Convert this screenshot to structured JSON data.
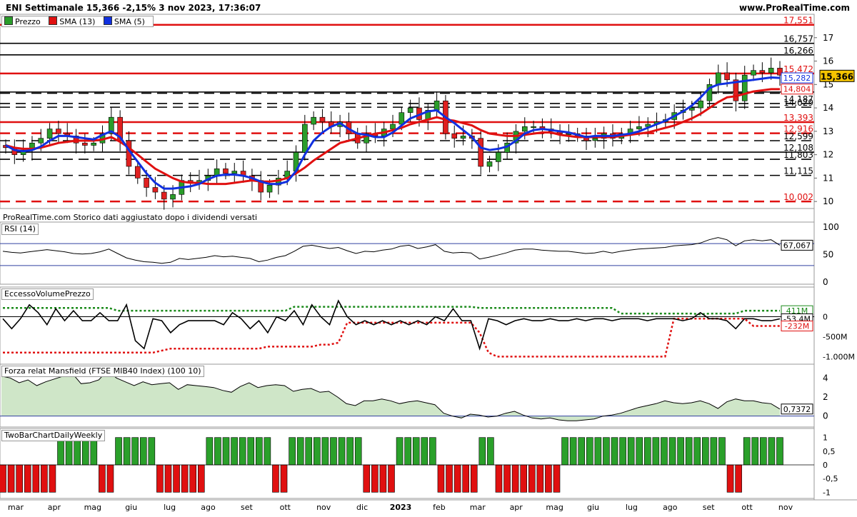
{
  "header": {
    "title": "ENI Settimanale 15,366 -2,15% 3 nov 2023, 17:36:07",
    "site": "www.ProRealTime.com"
  },
  "legend": {
    "price": "Prezzo",
    "sma13": "SMA (13)",
    "sma5": "SMA (5)"
  },
  "footer_note": "ProRealTime.com  Storico dati aggiustato dopo i dividendi versati",
  "colors": {
    "bull": "#2a9d2a",
    "bear": "#e02020",
    "sma13": "#e01010",
    "sma5": "#1030e0",
    "level_red": "#e01010",
    "level_black": "#000000"
  },
  "x_labels": [
    "mar",
    "apr",
    "mag",
    "giu",
    "lug",
    "ago",
    "set",
    "ott",
    "nov",
    "dic",
    "2023",
    "feb",
    "mar",
    "apr",
    "mag",
    "giu",
    "lug",
    "ago",
    "set",
    "ott",
    "nov"
  ],
  "chart_data": [
    {
      "type": "candlestick",
      "title": "ENI Settimanale",
      "ylim": [
        9.7,
        18
      ],
      "y_ticks": [
        "10",
        "11",
        "12",
        "13",
        "14",
        "15",
        "16",
        "17"
      ],
      "last_price": "15,366",
      "level_labels": [
        {
          "label": "17,551",
          "value": 17.551,
          "color": "red",
          "style": "solid"
        },
        {
          "label": "16,757",
          "value": 16.757,
          "color": "black",
          "style": "solid"
        },
        {
          "label": "16,266",
          "value": 16.266,
          "color": "black",
          "style": "solid"
        },
        {
          "label": "15,472",
          "value": 15.472,
          "color": "red",
          "style": "solid"
        },
        {
          "label": "14,678",
          "value": 14.678,
          "color": "black",
          "style": "solid"
        },
        {
          "label": "14,627",
          "value": 14.627,
          "color": "black",
          "style": "dashed"
        },
        {
          "label": "14,187",
          "value": 14.187,
          "color": "black",
          "style": "dashed"
        },
        {
          "label": "14,029",
          "value": 14.029,
          "color": "black",
          "style": "dashed"
        },
        {
          "label": "13,393",
          "value": 13.393,
          "color": "red",
          "style": "solid"
        },
        {
          "label": "12,916",
          "value": 12.916,
          "color": "red",
          "style": "dashed"
        },
        {
          "label": "12,599",
          "value": 12.599,
          "color": "black",
          "style": "dashed"
        },
        {
          "label": "12,108",
          "value": 12.108,
          "color": "black",
          "style": "solid"
        },
        {
          "label": "11,803",
          "value": 11.803,
          "color": "black",
          "style": "dashed"
        },
        {
          "label": "11,115",
          "value": 11.115,
          "color": "black",
          "style": "dashed"
        },
        {
          "label": "10,002",
          "value": 10.002,
          "color": "red",
          "style": "dashed"
        }
      ],
      "side_tags": [
        {
          "label": "15,282",
          "value": 15.282,
          "color": "blue"
        },
        {
          "label": "14,804",
          "value": 14.804,
          "color": "red"
        }
      ],
      "close": [
        12.3,
        12.0,
        12.2,
        12.5,
        12.7,
        13.1,
        12.9,
        12.8,
        12.5,
        12.4,
        12.5,
        12.9,
        13.6,
        12.6,
        11.5,
        11.0,
        10.6,
        10.4,
        10.1,
        10.3,
        10.9,
        10.8,
        10.9,
        11.1,
        11.4,
        11.2,
        11.3,
        11.1,
        10.9,
        10.4,
        10.7,
        11.0,
        11.3,
        12.1,
        13.3,
        13.6,
        13.4,
        13.2,
        13.4,
        12.9,
        12.5,
        12.9,
        12.8,
        13.1,
        13.3,
        13.8,
        14.0,
        13.5,
        13.9,
        14.3,
        12.9,
        12.7,
        12.8,
        12.7,
        11.5,
        11.7,
        12.1,
        12.5,
        13.0,
        13.2,
        13.2,
        13.1,
        13.0,
        12.9,
        12.9,
        12.8,
        12.6,
        12.7,
        12.9,
        12.7,
        12.9,
        13.1,
        13.2,
        13.3,
        13.4,
        13.5,
        13.8,
        13.9,
        14.0,
        14.3,
        15.0,
        15.5,
        15.2,
        14.3,
        15.4,
        15.6,
        15.5,
        15.7,
        15.4
      ],
      "sma13": [
        12.4,
        12.3,
        12.25,
        12.25,
        12.3,
        12.4,
        12.5,
        12.55,
        12.6,
        12.6,
        12.6,
        12.65,
        12.75,
        12.55,
        12.3,
        12.0,
        11.7,
        11.4,
        11.2,
        11.0,
        10.85,
        10.8,
        10.8,
        10.75,
        10.75,
        10.75,
        10.8,
        10.85,
        10.9,
        10.85,
        10.85,
        10.9,
        11.0,
        11.2,
        11.45,
        11.75,
        12.0,
        12.25,
        12.5,
        12.6,
        12.7,
        12.8,
        12.9,
        12.95,
        13.05,
        13.15,
        13.3,
        13.4,
        13.5,
        13.6,
        13.5,
        13.45,
        13.35,
        13.25,
        13.05,
        12.9,
        12.85,
        12.8,
        12.8,
        12.85,
        12.9,
        12.95,
        12.95,
        12.85,
        12.8,
        12.75,
        12.75,
        12.75,
        12.75,
        12.75,
        12.8,
        12.85,
        12.9,
        12.95,
        13.05,
        13.15,
        13.25,
        13.4,
        13.55,
        13.75,
        14.0,
        14.25,
        14.45,
        14.5,
        14.6,
        14.7,
        14.75,
        14.8,
        14.8
      ],
      "sma5": [
        12.4,
        12.2,
        12.15,
        12.2,
        12.35,
        12.6,
        12.8,
        12.8,
        12.75,
        12.7,
        12.65,
        12.85,
        13.0,
        12.75,
        12.2,
        11.7,
        11.2,
        10.8,
        10.55,
        10.55,
        10.6,
        10.65,
        10.75,
        10.95,
        11.1,
        11.15,
        11.15,
        11.1,
        11.0,
        10.85,
        10.75,
        10.75,
        10.85,
        11.3,
        12.0,
        12.6,
        12.95,
        13.2,
        13.35,
        13.1,
        12.9,
        12.85,
        12.75,
        12.75,
        12.95,
        13.25,
        13.55,
        13.7,
        13.85,
        13.9,
        13.6,
        13.35,
        13.05,
        12.75,
        12.3,
        12.2,
        12.25,
        12.35,
        12.6,
        12.9,
        13.05,
        13.1,
        13.05,
        13.0,
        12.95,
        12.85,
        12.75,
        12.8,
        12.8,
        12.8,
        12.85,
        12.9,
        13.0,
        13.15,
        13.3,
        13.45,
        13.65,
        13.85,
        14.1,
        14.45,
        14.85,
        15.0,
        15.05,
        15.1,
        15.15,
        15.2,
        15.25,
        15.3,
        15.28
      ]
    },
    {
      "type": "line",
      "title": "RSI (14)",
      "ylim": [
        0,
        100
      ],
      "y_ticks": [
        "100",
        "50",
        "0"
      ],
      "last_value_label": "67,067",
      "values": [
        56,
        54,
        53,
        55,
        57,
        59,
        57,
        55,
        52,
        51,
        52,
        55,
        60,
        52,
        44,
        40,
        37,
        36,
        34,
        36,
        43,
        41,
        43,
        45,
        48,
        46,
        47,
        45,
        43,
        37,
        40,
        45,
        48,
        56,
        65,
        67,
        64,
        61,
        63,
        57,
        52,
        56,
        55,
        58,
        60,
        65,
        67,
        61,
        64,
        68,
        56,
        53,
        54,
        53,
        42,
        45,
        49,
        53,
        58,
        60,
        60,
        58,
        57,
        56,
        56,
        54,
        52,
        53,
        56,
        53,
        56,
        58,
        60,
        61,
        62,
        63,
        66,
        67,
        68,
        71,
        77,
        81,
        77,
        66,
        75,
        77,
        75,
        77,
        67
      ]
    },
    {
      "type": "line",
      "title": "EccessoVolumePrezzo",
      "ylim": [
        -1100,
        600
      ],
      "y_ticks": [
        "0",
        "-500M",
        "-1.000M"
      ],
      "last_value_label": "-53,4M",
      "upper_band_label": "411M",
      "lower_band_label": "-232M",
      "values": [
        -50,
        -300,
        -50,
        300,
        100,
        -200,
        200,
        -100,
        150,
        -100,
        -100,
        100,
        -100,
        -100,
        300,
        -600,
        -800,
        -50,
        -100,
        -400,
        -200,
        -100,
        -100,
        -100,
        -100,
        -200,
        100,
        -50,
        -300,
        -100,
        -400,
        0,
        -100,
        150,
        -200,
        300,
        0,
        -200,
        400,
        0,
        -200,
        -100,
        -200,
        -100,
        -200,
        -100,
        -200,
        -100,
        -200,
        0,
        -100,
        200,
        -100,
        -100,
        -800,
        -50,
        -100,
        -200,
        -100,
        -50,
        -100,
        -100,
        -50,
        -100,
        -100,
        -50,
        -100,
        -50,
        -50,
        -100,
        -50,
        -50,
        -50,
        -100,
        -50,
        -50,
        -50,
        -100,
        -50,
        100,
        -50,
        -50,
        -100,
        -300,
        -50,
        -50,
        -100,
        -100,
        -53
      ]
    },
    {
      "type": "area",
      "title": "Forza relat Mansfield (FTSE MIB40 Index) (100 10)",
      "ylim": [
        -1,
        5
      ],
      "y_ticks": [
        "4",
        "2",
        "0"
      ],
      "last_value_label": "0,7372",
      "values": [
        4.2,
        4.0,
        3.5,
        3.8,
        3.2,
        3.6,
        3.9,
        4.2,
        4.5,
        3.4,
        3.5,
        3.8,
        4.8,
        4.0,
        3.6,
        3.2,
        3.6,
        3.3,
        3.4,
        3.5,
        2.8,
        3.3,
        3.2,
        3.1,
        3.0,
        2.7,
        2.5,
        3.1,
        3.5,
        3.0,
        3.2,
        3.3,
        3.2,
        2.6,
        2.8,
        2.9,
        2.5,
        2.6,
        2.0,
        1.3,
        1.1,
        1.6,
        1.6,
        1.8,
        1.6,
        1.3,
        1.5,
        1.6,
        1.4,
        1.2,
        0.3,
        0.0,
        -0.2,
        0.2,
        0.1,
        -0.1,
        0.0,
        0.3,
        0.5,
        0.1,
        -0.2,
        -0.3,
        -0.2,
        -0.4,
        -0.5,
        -0.5,
        -0.4,
        -0.3,
        0.0,
        0.1,
        0.3,
        0.6,
        0.9,
        1.1,
        1.3,
        1.6,
        1.4,
        1.3,
        1.4,
        1.6,
        1.3,
        0.8,
        1.5,
        1.8,
        1.6,
        1.6,
        1.4,
        1.3,
        0.74
      ]
    },
    {
      "type": "bar",
      "title": "TwoBarChartDailyWeekly",
      "ylim": [
        -1.2,
        1.2
      ],
      "y_ticks": [
        "1",
        "0,5",
        "0",
        "-0,5",
        "-1"
      ],
      "values": [
        -1,
        -1,
        -1,
        -1,
        -1,
        -1,
        -1,
        1,
        1,
        1,
        1,
        1,
        -1,
        -1,
        1,
        1,
        1,
        1,
        1,
        -1,
        -1,
        -1,
        -1,
        -1,
        -1,
        1,
        1,
        1,
        1,
        1,
        1,
        1,
        1,
        -1,
        -1,
        1,
        1,
        1,
        1,
        1,
        1,
        1,
        1,
        1,
        -1,
        -1,
        -1,
        -1,
        1,
        1,
        1,
        1,
        1,
        -1,
        -1,
        -1,
        -1,
        -1,
        1,
        1,
        -1,
        -1,
        -1,
        -1,
        -1,
        -1,
        -1,
        -1,
        1,
        1,
        1,
        1,
        1,
        1,
        1,
        1,
        1,
        1,
        1,
        1,
        1,
        1,
        1,
        1,
        1,
        1,
        1,
        1,
        -1,
        -1,
        1,
        1,
        1,
        1,
        1
      ]
    }
  ]
}
